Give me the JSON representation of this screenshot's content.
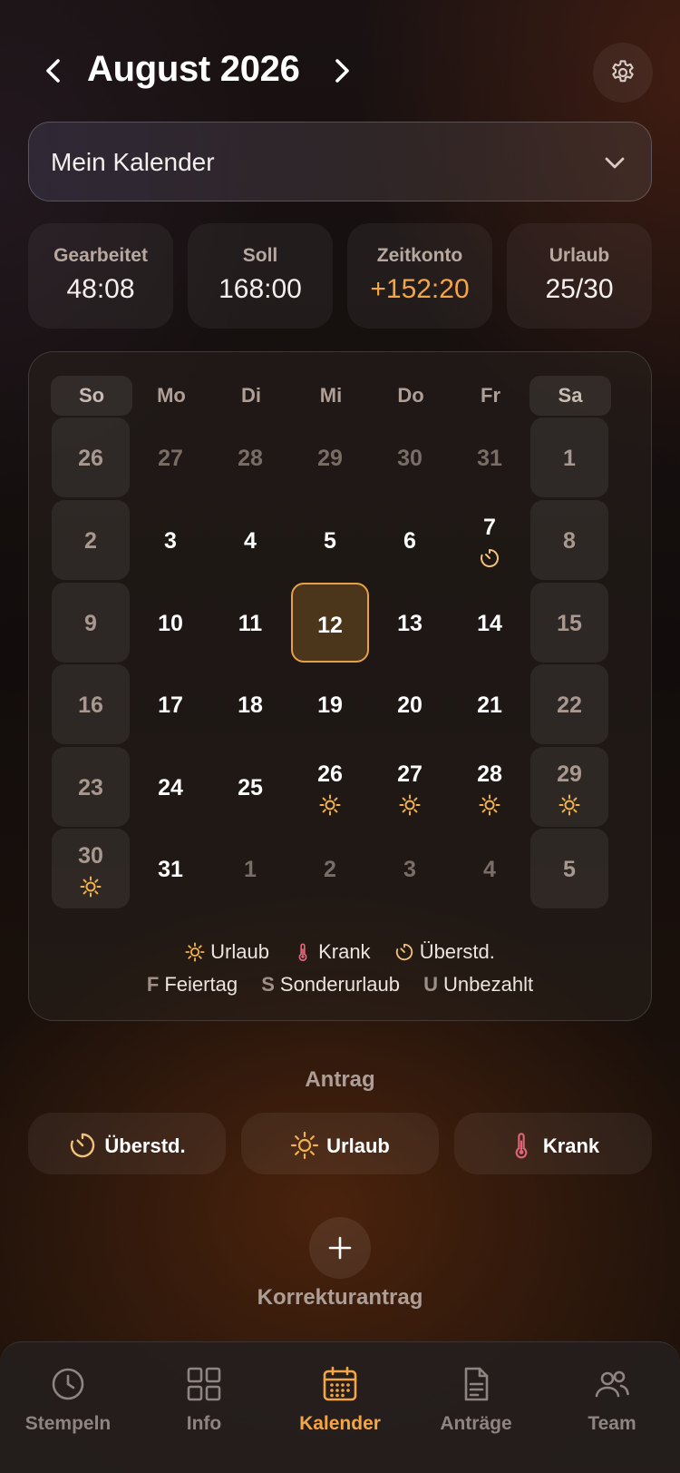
{
  "header": {
    "month_title": "August 2026"
  },
  "calendar_select": {
    "selected": "Mein Kalender"
  },
  "stats": [
    {
      "label": "Gearbeitet",
      "value": "48:08"
    },
    {
      "label": "Soll",
      "value": "168:00"
    },
    {
      "label": "Zeitkonto",
      "value": "+152:20"
    },
    {
      "label": "Urlaub",
      "value": "25/30"
    }
  ],
  "calendar": {
    "weekdays": [
      "So",
      "Mo",
      "Di",
      "Mi",
      "Do",
      "Fr",
      "Sa"
    ],
    "days": [
      [
        "26",
        "27",
        "28",
        "29",
        "30",
        "31",
        "1"
      ],
      [
        "2",
        "3",
        "4",
        "5",
        "6",
        "7",
        "8"
      ],
      [
        "9",
        "10",
        "11",
        "12",
        "13",
        "14",
        "15"
      ],
      [
        "16",
        "17",
        "18",
        "19",
        "20",
        "21",
        "22"
      ],
      [
        "23",
        "24",
        "25",
        "26",
        "27",
        "28",
        "29"
      ],
      [
        "30",
        "31",
        "1",
        "2",
        "3",
        "4",
        "5"
      ]
    ]
  },
  "legend": {
    "vacation": "Urlaub",
    "sick": "Krank",
    "overtime": "Überstd.",
    "holiday_key": "F",
    "holiday": "Feiertag",
    "special_key": "S",
    "special": "Sonderurlaub",
    "unpaid_key": "U",
    "unpaid": "Unbezahlt"
  },
  "request": {
    "title": "Antrag",
    "overtime_button": "Überstd.",
    "vacation_button": "Urlaub",
    "sick_button": "Krank",
    "correction_label": "Korrekturantrag"
  },
  "tabs": [
    {
      "label": "Stempeln"
    },
    {
      "label": "Info"
    },
    {
      "label": "Kalender"
    },
    {
      "label": "Anträge"
    },
    {
      "label": "Team"
    }
  ],
  "colors": {
    "accent": "#f4a545",
    "sun": "#f4b24a",
    "sick": "#e0657a",
    "overtime": "#f2c27a"
  }
}
